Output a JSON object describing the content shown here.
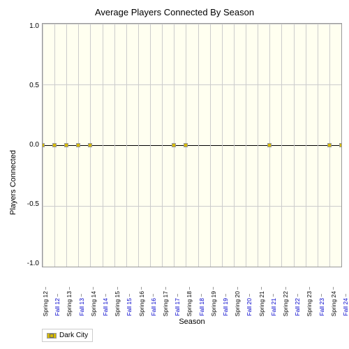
{
  "chart": {
    "title": "Average Players Connected By Season",
    "y_axis_label": "Players Connected",
    "x_axis_label": "Season",
    "y_ticks": [
      "1.0",
      "0.5",
      "0.0",
      "-0.5",
      "-1.0"
    ],
    "y_tick_positions": [
      0,
      25,
      50,
      75,
      100
    ],
    "x_labels": [
      {
        "label": "Spring 12",
        "blue": false
      },
      {
        "label": "Fall 12",
        "blue": true
      },
      {
        "label": "Spring 13",
        "blue": false
      },
      {
        "label": "Fall 13",
        "blue": true
      },
      {
        "label": "Spring 14",
        "blue": false
      },
      {
        "label": "Fall 14",
        "blue": true
      },
      {
        "label": "Spring 15",
        "blue": false
      },
      {
        "label": "Fall 15",
        "blue": true
      },
      {
        "label": "Spring 16",
        "blue": false
      },
      {
        "label": "Fall 16",
        "blue": true
      },
      {
        "label": "Spring 17",
        "blue": false
      },
      {
        "label": "Fall 17",
        "blue": true
      },
      {
        "label": "Spring 18",
        "blue": false
      },
      {
        "label": "Fall 18",
        "blue": true
      },
      {
        "label": "Spring 19",
        "blue": false
      },
      {
        "label": "Fall 19",
        "blue": true
      },
      {
        "label": "Spring 20",
        "blue": false
      },
      {
        "label": "Fall 20",
        "blue": true
      },
      {
        "label": "Spring 21",
        "blue": false
      },
      {
        "label": "Fall 21",
        "blue": true
      },
      {
        "label": "Spring 22",
        "blue": false
      },
      {
        "label": "Fall 22",
        "blue": true
      },
      {
        "label": "Spring 23",
        "blue": false
      },
      {
        "label": "Fall 23",
        "blue": true
      },
      {
        "label": "Spring 24",
        "blue": false
      },
      {
        "label": "Fall 24",
        "blue": true
      }
    ],
    "data_points": [
      {
        "x_index": 0,
        "y_val": 0
      },
      {
        "x_index": 1,
        "y_val": 0
      },
      {
        "x_index": 2,
        "y_val": 0
      },
      {
        "x_index": 3,
        "y_val": 0
      },
      {
        "x_index": 4,
        "y_val": 0
      },
      {
        "x_index": 11,
        "y_val": 0
      },
      {
        "x_index": 12,
        "y_val": 0
      },
      {
        "x_index": 19,
        "y_val": 0
      },
      {
        "x_index": 24,
        "y_val": 0
      },
      {
        "x_index": 25,
        "y_val": 0
      }
    ],
    "legend": {
      "label": "Dark City",
      "color": "#d4b800"
    }
  }
}
